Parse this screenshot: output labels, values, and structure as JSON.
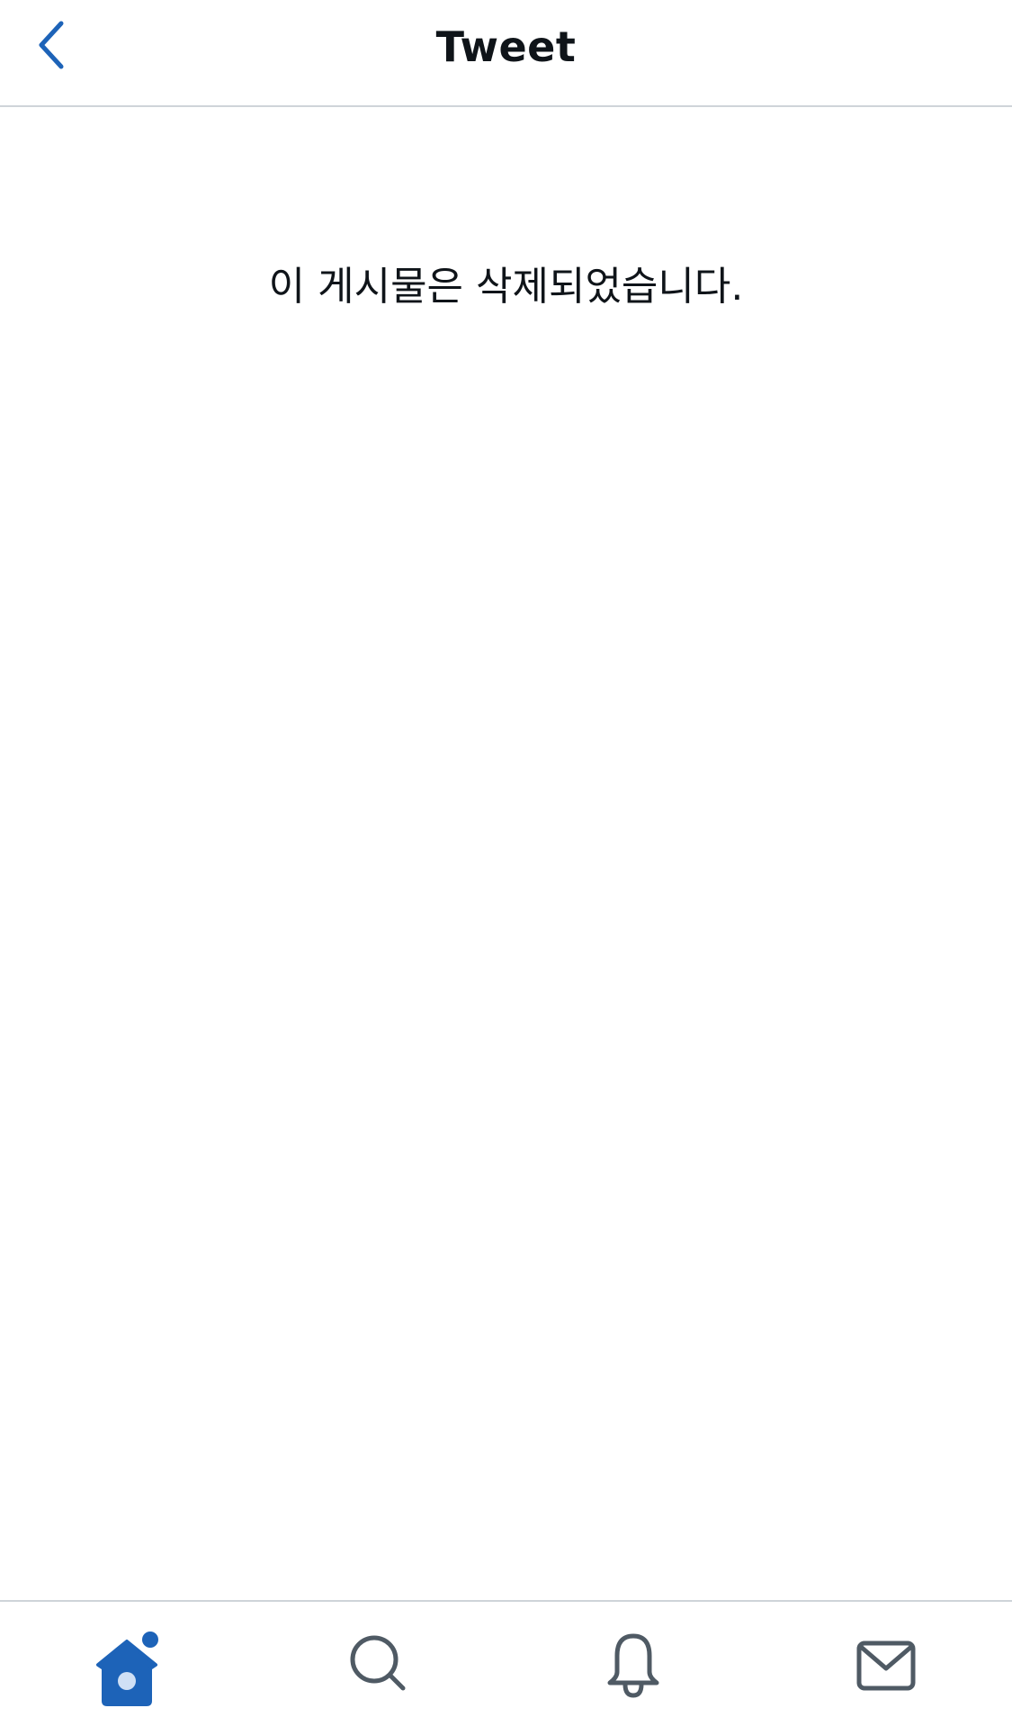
{
  "header": {
    "back_icon": "chevron-left-icon",
    "title": "Tweet"
  },
  "main": {
    "message": "이 게시물은 삭제되었습니다."
  },
  "tabbar": {
    "items": [
      {
        "id": "home",
        "icon": "home-icon",
        "active": true,
        "has_indicator": true
      },
      {
        "id": "search",
        "icon": "search-icon",
        "active": false
      },
      {
        "id": "notifications",
        "icon": "bell-icon",
        "active": false
      },
      {
        "id": "messages",
        "icon": "envelope-icon",
        "active": false
      }
    ]
  },
  "colors": {
    "accent": "#1d63b8",
    "icon_inactive": "#4f5a64",
    "divider": "#cfd4d9",
    "text": "#0f1419",
    "background": "#ffffff"
  }
}
